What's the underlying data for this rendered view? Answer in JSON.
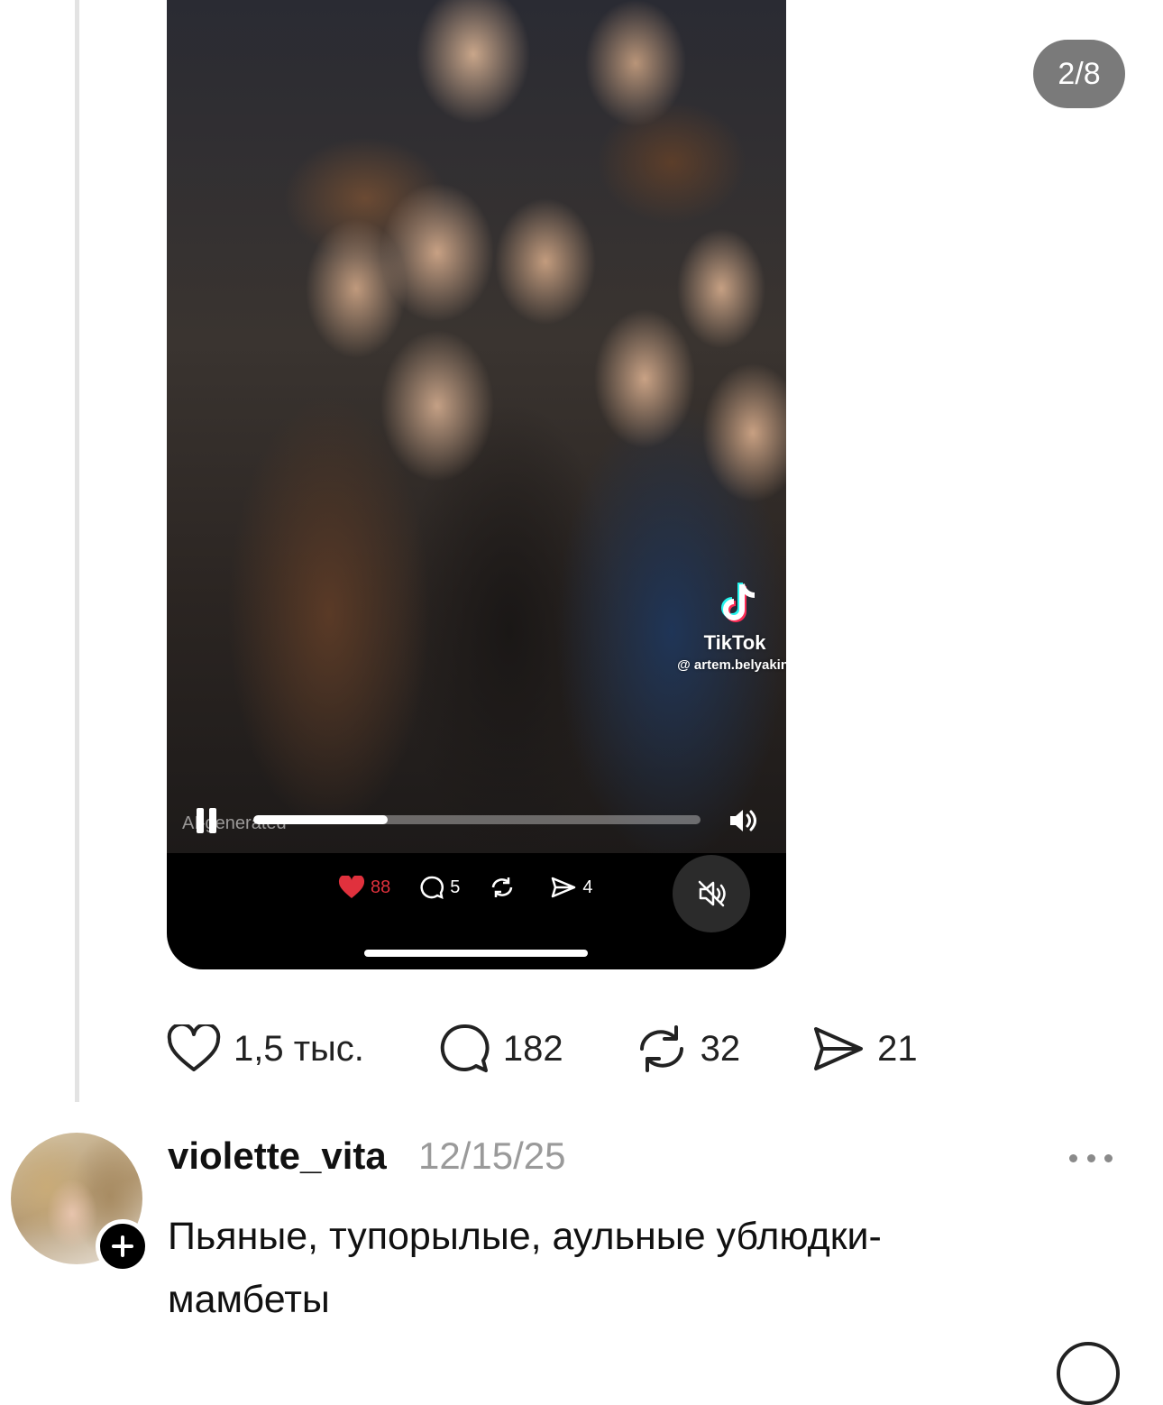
{
  "carousel": {
    "counter": "2/8"
  },
  "video": {
    "watermark": {
      "brand": "TikTok",
      "handle": "@ artem.belyakin"
    },
    "ai_label": "AI-generated",
    "progress": 0.3,
    "actions": {
      "likes": "88",
      "comments": "5",
      "reposts": "",
      "shares": "4"
    }
  },
  "post_actions": {
    "likes": "1,5 тыс.",
    "comments": "182",
    "reposts": "32",
    "shares": "21"
  },
  "reply": {
    "username": "violette_vita",
    "date": "12/15/25",
    "text": "Пьяные, тупорылые, аульные ублюдки-мамбеты"
  },
  "colors": {
    "like_red": "#e0313d",
    "counter_bg": "#7a7a7a",
    "thread_line": "#e3e3e3"
  }
}
